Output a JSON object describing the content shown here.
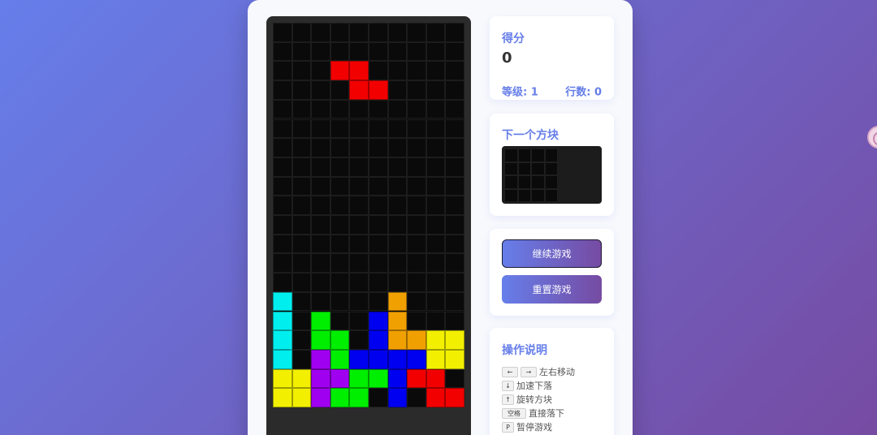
{
  "score": {
    "title": "得分",
    "value": "0",
    "level_text": "等级: 1",
    "lines_text": "行数: 0"
  },
  "next": {
    "title": "下一个方块"
  },
  "buttons": {
    "resume": "继续游戏",
    "reset": "重置游戏"
  },
  "help": {
    "title": "操作说明",
    "items": [
      {
        "keys": [
          "←",
          "→"
        ],
        "text": "左右移动"
      },
      {
        "keys": [
          "↓"
        ],
        "text": "加速下落"
      },
      {
        "keys": [
          "↑"
        ],
        "text": "旋转方块"
      },
      {
        "keys": [
          "空格"
        ],
        "text": "直接落下"
      },
      {
        "keys": [
          "P"
        ],
        "text": "暂停游戏"
      }
    ]
  },
  "colors": {
    "R": "#f20000",
    "C": "#00eeee",
    "G": "#00ee00",
    "B": "#0000f0",
    "O": "#f0a000",
    "Y": "#f2f000",
    "P": "#a000f0"
  },
  "board": {
    "cols": 10,
    "rows": 20,
    "grid": [
      "..........",
      "..........",
      "...RR.....",
      "....RR....",
      "..........",
      "..........",
      "..........",
      "..........",
      "..........",
      "..........",
      "..........",
      "..........",
      "..........",
      "..........",
      "C.....O...",
      "C.G..BO...",
      "C.GG.BOOYY",
      "C.PGBBBBYY",
      "YYPPGGBRR.",
      "YYPGG.B.RR"
    ]
  }
}
